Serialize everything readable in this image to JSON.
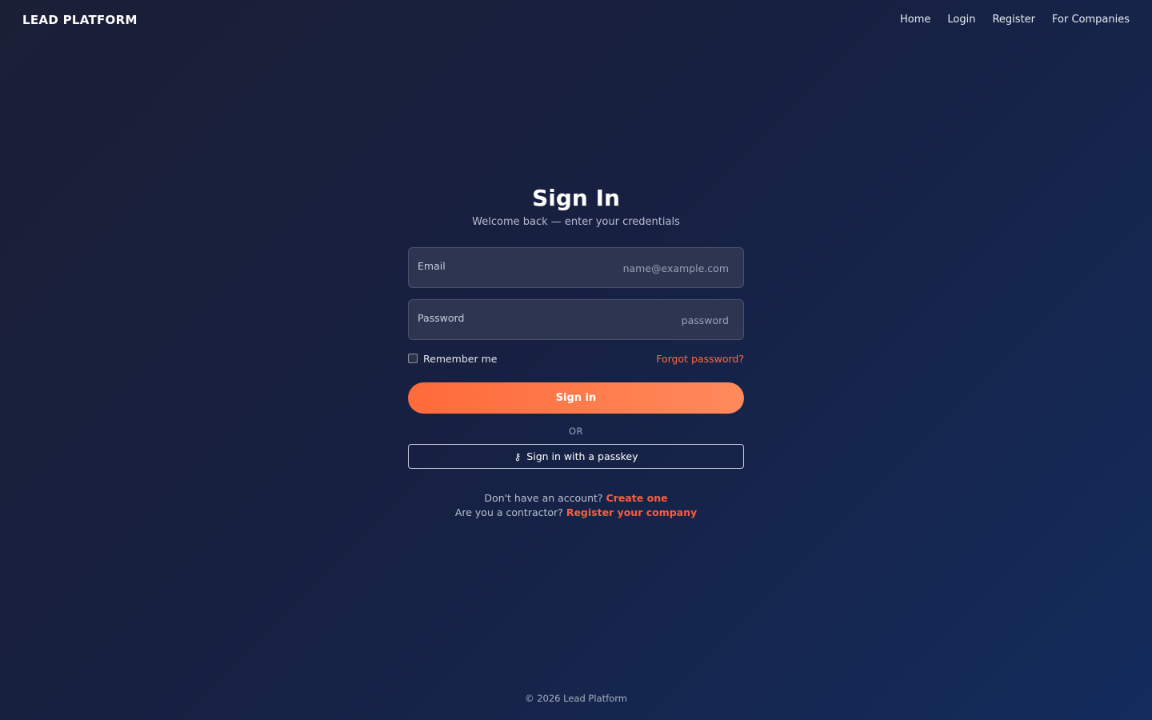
{
  "header": {
    "brand": "LEAD PLATFORM",
    "nav": [
      "Home",
      "Login",
      "Register",
      "For Companies"
    ]
  },
  "signin": {
    "title": "Sign In",
    "subtitle": "Welcome back — enter your credentials",
    "email_label": "Email",
    "email_placeholder": "name@example.com",
    "password_label": "Password",
    "password_placeholder": "password",
    "remember_label": "Remember me",
    "forgot_label": "Forgot password?",
    "submit_label": "Sign in",
    "or_label": "OR",
    "passkey_icon": "key-icon",
    "passkey_label": "Sign in with a passkey"
  },
  "links": {
    "no_account_text": "Don't have an account?",
    "create_label": "Create one",
    "contractor_text": "Are you a contractor?",
    "register_company_label": "Register your company"
  },
  "footer": {
    "copyright": "© 2026 Lead Platform"
  },
  "colors": {
    "accent": "#ff6a3a",
    "link": "#ff5b3d",
    "background_start": "#1b1f36",
    "background_end": "#132c5c"
  }
}
